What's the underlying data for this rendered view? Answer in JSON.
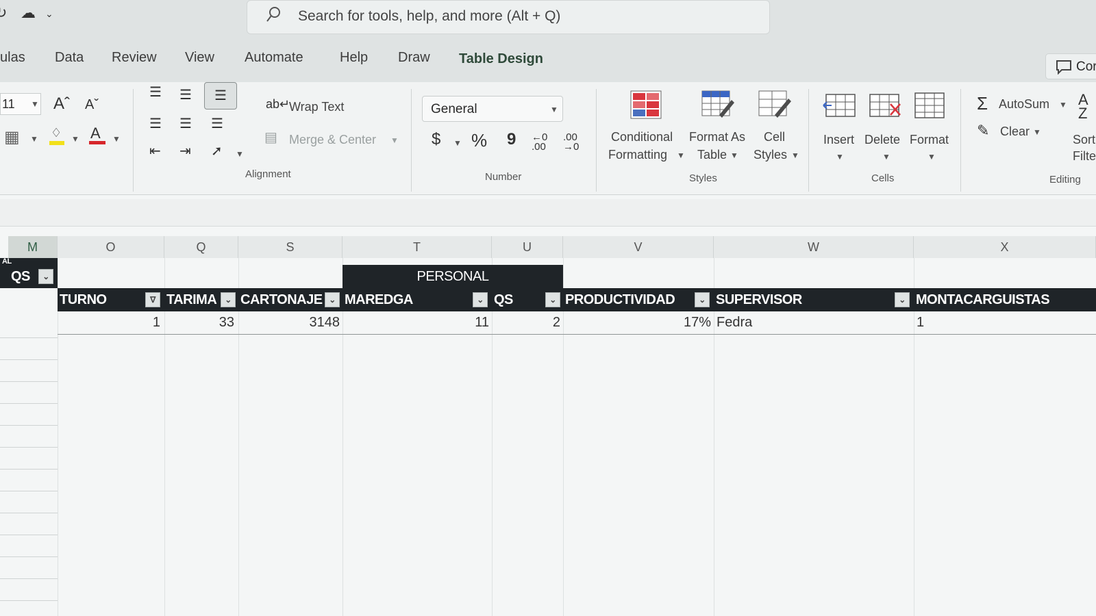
{
  "titlebar": {
    "search_placeholder": "Search for tools, help, and more (Alt + Q)"
  },
  "menu": {
    "tabs": [
      "ulas",
      "Data",
      "Review",
      "View",
      "Automate",
      "Help",
      "Draw",
      "Table Design"
    ],
    "active_tab": "Table Design",
    "comments_label": "Cor"
  },
  "ribbon": {
    "font": {
      "size_value": "11"
    },
    "alignment": {
      "wrap_text": "Wrap Text",
      "merge_center": "Merge & Center",
      "group_label": "Alignment"
    },
    "number": {
      "format_value": "General",
      "currency": "$",
      "percent": "%",
      "comma": "9",
      "group_label": "Number"
    },
    "styles": {
      "conditional_line1": "Conditional",
      "conditional_line2": "Formatting",
      "format_table_line1": "Format As",
      "format_table_line2": "Table",
      "cell_styles_line1": "Cell",
      "cell_styles_line2": "Styles",
      "group_label": "Styles"
    },
    "cells": {
      "insert": "Insert",
      "delete": "Delete",
      "format": "Format",
      "group_label": "Cells"
    },
    "editing": {
      "autosum": "AutoSum",
      "clear": "Clear",
      "sort_line1": "Sort",
      "sort_line2": "Filte",
      "group_label": "Editing"
    }
  },
  "sheet": {
    "columns": [
      "M",
      "O",
      "Q",
      "S",
      "T",
      "U",
      "V",
      "W",
      "X"
    ],
    "selected_column": "M",
    "merged_header": "PERSONAL",
    "left_partial_top": "AL",
    "left_header": "QS",
    "headers": [
      "TURNO",
      "TARIMA",
      "CARTONAJE",
      "MAREDGA",
      "QS",
      "PRODUCTIVIDAD",
      "SUPERVISOR",
      "MONTACARGUISTAS"
    ],
    "row1": [
      "1",
      "33",
      "3148",
      "11",
      "2",
      "17%",
      "Fedra",
      "1"
    ]
  }
}
